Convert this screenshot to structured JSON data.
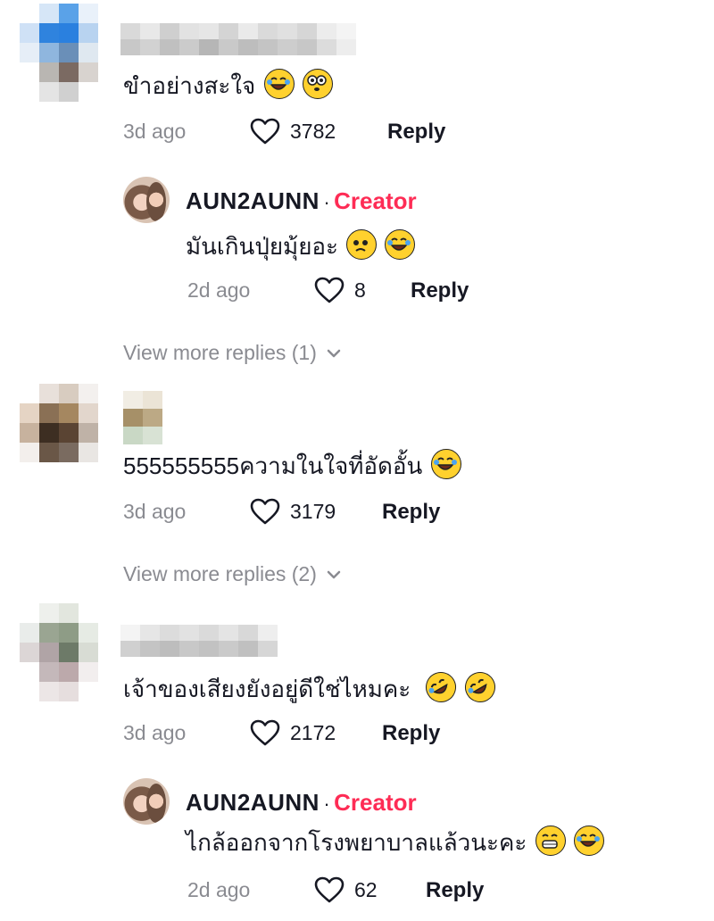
{
  "comments": [
    {
      "text": "ขำอย่างสะใจ",
      "emojis": [
        "laughing-tears",
        "flushed"
      ],
      "time": "3d ago",
      "likes": "3782",
      "reply_label": "Reply",
      "reply": {
        "name": "AUN2AUNN",
        "separator": "·",
        "badge": "Creator",
        "text": "มันเกินปุ่ยมุ้ยอะ",
        "emojis": [
          "pleading",
          "laughing-tears"
        ],
        "time": "2d ago",
        "likes": "8",
        "reply_label": "Reply"
      },
      "view_more": "View more replies (1)"
    },
    {
      "text": "555555555ความในใจที่อัดอั้น",
      "emojis": [
        "laughing-tears"
      ],
      "time": "3d ago",
      "likes": "3179",
      "reply_label": "Reply",
      "view_more": "View more replies (2)"
    },
    {
      "text": "เจ้าของเสียงยังอยู่ดีใช่ไหมคะ",
      "emojis": [
        "rofl",
        "rofl"
      ],
      "time": "3d ago",
      "likes": "2172",
      "reply_label": "Reply",
      "reply": {
        "name": "AUN2AUNN",
        "separator": "·",
        "badge": "Creator",
        "text": "ไกล้ออกจากโรงพยาบาลแล้วนะคะ",
        "emojis": [
          "grinning",
          "laughing-tears"
        ],
        "time": "2d ago",
        "likes": "62",
        "reply_label": "Reply"
      }
    }
  ],
  "colors": {
    "creator": "#fe2c55",
    "meta": "#8a8b91",
    "text": "#161823",
    "emoji": "#ffd12e"
  }
}
